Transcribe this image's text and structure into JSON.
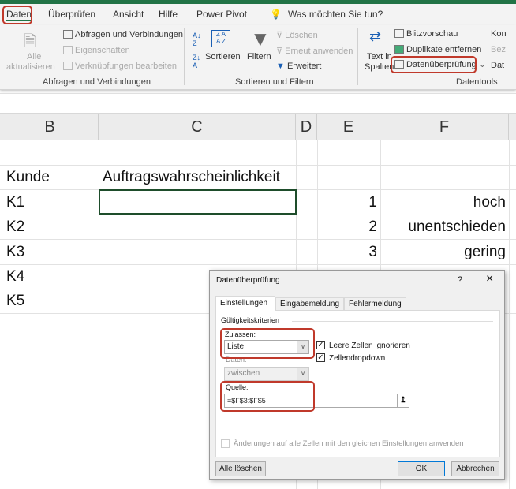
{
  "tabs": [
    "Daten",
    "Überprüfen",
    "Ansicht",
    "Hilfe",
    "Power Pivot"
  ],
  "tell_me": "Was möchten Sie tun?",
  "ribbon": {
    "refresh_all": [
      "Alle",
      "aktualisieren"
    ],
    "queries": "Abfragen und Verbindungen",
    "properties": "Eigenschaften",
    "edit_links": "Verknüpfungen bearbeiten",
    "group_queries": "Abfragen und Verbindungen",
    "sort": "Sortieren",
    "filter": "Filtern",
    "clear": "Löschen",
    "reapply": "Erneut anwenden",
    "advanced": "Erweitert",
    "group_sort": "Sortieren und Filtern",
    "text_to_cols": [
      "Text in",
      "Spalten"
    ],
    "flash_fill": "Blitzvorschau",
    "remove_dup": "Duplikate entfernen",
    "data_validation": "Datenüberprüfung",
    "consolidate": "Kon",
    "relations": "Bez",
    "datamodel": "Dat",
    "group_tools": "Datentools"
  },
  "columns": [
    "B",
    "C",
    "D",
    "E",
    "F"
  ],
  "cells": {
    "b2": "Kunde",
    "c2": "Auftragswahrscheinlichkeit",
    "customers": [
      "K1",
      "K2",
      "K3",
      "K4",
      "K5"
    ],
    "e": [
      "1",
      "2",
      "3"
    ],
    "f": [
      "hoch",
      "unentschieden",
      "gering"
    ]
  },
  "dialog": {
    "title": "Datenüberprüfung",
    "help": "?",
    "close": "×",
    "tabs": [
      "Einstellungen",
      "Eingabemeldung",
      "Fehlermeldung"
    ],
    "criteria": "Gültigkeitskriterien",
    "allow_label": "Zulassen:",
    "allow_value": "Liste",
    "ignore_blank": "Leere Zellen ignorieren",
    "ignore_blank_checked": true,
    "in_cell_dropdown": "Zellendropdown",
    "in_cell_dropdown_checked": true,
    "data_label": "Daten:",
    "data_value": "zwischen",
    "source_label": "Quelle:",
    "source_value": "=$F$3:$F$5",
    "apply_all": "Änderungen auf alle Zellen mit den gleichen Einstellungen anwenden",
    "clear_all": "Alle löschen",
    "ok": "OK",
    "cancel": "Abbrechen"
  },
  "colors": {
    "accent": "#217346",
    "highlight": "#c0392b"
  }
}
